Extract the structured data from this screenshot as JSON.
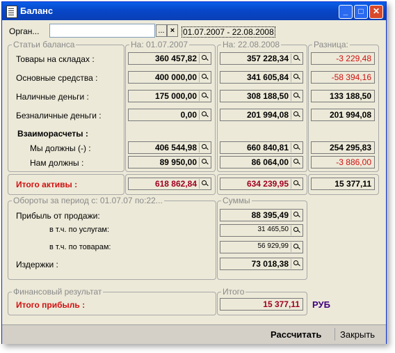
{
  "window": {
    "title": "Баланс"
  },
  "header": {
    "organ_label": "Орган...",
    "organ_value": "",
    "ellipsis": "...",
    "clear": "×",
    "period": "01.07.2007 - 22.08.2008"
  },
  "groups": {
    "balance_items": "Статьи баланса",
    "start": "На: 01.07.2007",
    "end": "На: 22.08.2008",
    "diff": "Разница:",
    "turnover": "Обороты за период с: 01.07.07 по:22...",
    "sums": "Суммы",
    "fin_result": "Финансовый результат",
    "total": "Итого"
  },
  "rows": [
    {
      "label": "Товары на складах :",
      "start": "360 457,82",
      "end": "357 228,34",
      "diff": "-3 229,48"
    },
    {
      "label": "Основные средства :",
      "start": "400 000,00",
      "end": "341 605,84",
      "diff": "-58 394,16"
    },
    {
      "label": "Наличные деньги :",
      "start": "175 000,00",
      "end": "308 188,50",
      "diff": "133 188,50"
    },
    {
      "label": "Безналичные деньги :",
      "start": "0,00",
      "end": "201 994,08",
      "diff": "201 994,08"
    }
  ],
  "settlements": {
    "title": "Взаиморасчеты :"
  },
  "settle_rows": [
    {
      "label": "Мы должны (-) :",
      "start": "406 544,98",
      "end": "660 840,81",
      "diff": "254 295,83"
    },
    {
      "label": "Нам должны :",
      "start": "89 950,00",
      "end": "86 064,00",
      "diff": "-3 886,00"
    }
  ],
  "assets": {
    "label": "Итого активы :",
    "start": "618 862,84",
    "end": "634 239,95",
    "diff": "15 377,11"
  },
  "turnover_rows": [
    {
      "label": "Прибыль от продажи:",
      "value": "88 395,49"
    },
    {
      "label": "в т.ч. по услугам:",
      "value": "31 465,50"
    },
    {
      "label": "в т.ч. по товарам:",
      "value": "56 929,99"
    },
    {
      "label": "Издержки :",
      "value": "73 018,38"
    }
  ],
  "profit": {
    "label": "Итого прибыль :",
    "value": "15 377,11",
    "currency": "РУБ"
  },
  "buttons": {
    "calculate": "Рассчитать",
    "close": "Закрыть"
  },
  "colors": {
    "titlebar": "#0a5fe8",
    "negative": "#d01010",
    "total": "#a00020",
    "currency": "#400080"
  }
}
